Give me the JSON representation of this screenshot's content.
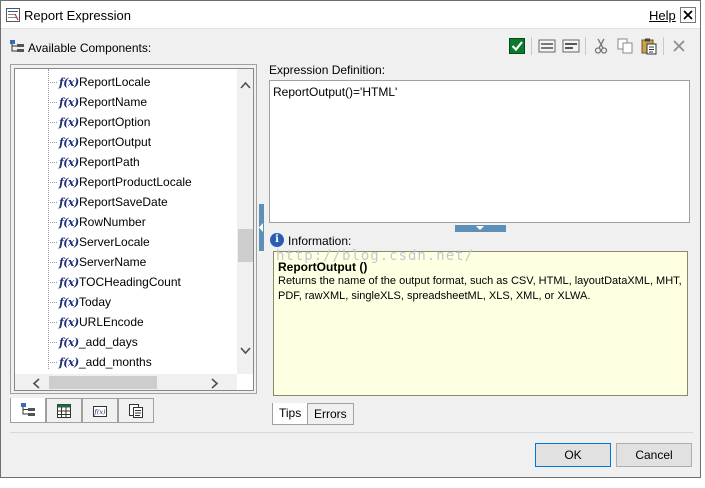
{
  "window": {
    "title": "Report Expression",
    "help_label": "Help",
    "close_glyph": "✕"
  },
  "available_components": {
    "label": "Available Components:"
  },
  "tree": {
    "items": [
      {
        "label": "ReportLocale"
      },
      {
        "label": "ReportName"
      },
      {
        "label": "ReportOption"
      },
      {
        "label": "ReportOutput"
      },
      {
        "label": "ReportPath"
      },
      {
        "label": "ReportProductLocale"
      },
      {
        "label": "ReportSaveDate"
      },
      {
        "label": "RowNumber"
      },
      {
        "label": "ServerLocale"
      },
      {
        "label": "ServerName"
      },
      {
        "label": "TOCHeadingCount"
      },
      {
        "label": "Today"
      },
      {
        "label": "URLEncode"
      },
      {
        "label": "_add_days"
      },
      {
        "label": "_add_months"
      }
    ],
    "function_icon_text": "f(x)"
  },
  "toolbar": {
    "icons": [
      "validate-check-icon",
      "insert-icon",
      "remove-icon",
      "cut-icon",
      "copy-icon",
      "paste-icon",
      "delete-icon"
    ]
  },
  "expression": {
    "label": "Expression Definition:",
    "value": "ReportOutput()='HTML'"
  },
  "information": {
    "label": "Information:",
    "icon_text": "i",
    "title": "ReportOutput ()",
    "description": "Returns the name of the output format, such as CSV, HTML, layoutDataXML, MHT, PDF, rawXML, singleXLS, spreadsheetML, XLS, XML, or XLWA."
  },
  "watermark": "http://blog.csdn.net/",
  "bottom_tabs": [
    {
      "label": "Tips",
      "active": true
    },
    {
      "label": "Errors",
      "active": false
    }
  ],
  "buttons": {
    "ok": "OK",
    "cancel": "Cancel"
  },
  "colors": {
    "info_background": "#ffffe1",
    "splitter": "#5e8fb7",
    "function_icon": "#1a2e7a",
    "dialog_background": "#f0f0f0"
  }
}
